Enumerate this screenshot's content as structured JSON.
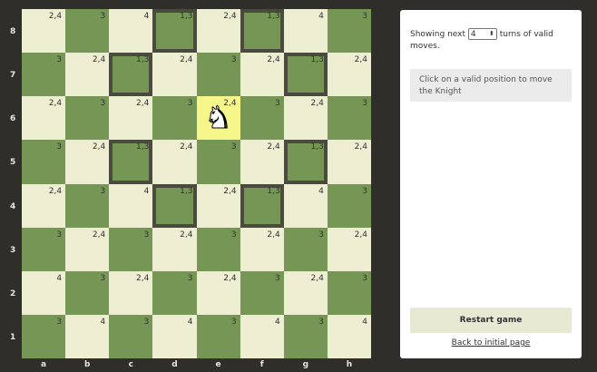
{
  "board": {
    "files": [
      "a",
      "b",
      "c",
      "d",
      "e",
      "f",
      "g",
      "h"
    ],
    "ranks": [
      "8",
      "7",
      "6",
      "5",
      "4",
      "3",
      "2",
      "1"
    ],
    "knight_square": "e6",
    "knight_glyph": "♞",
    "highlighted_squares": [
      "d8",
      "f8",
      "c7",
      "g7",
      "c5",
      "g5",
      "d4",
      "f4"
    ],
    "moves": [
      [
        "2,4",
        "3",
        "4",
        "1,3",
        "2,4",
        "1,3",
        "4",
        "3"
      ],
      [
        "3",
        "2,4",
        "1,3",
        "2,4",
        "3",
        "2,4",
        "1,3",
        "2,4"
      ],
      [
        "2,4",
        "3",
        "2,4",
        "3",
        "2,4",
        "3",
        "2,4",
        "3"
      ],
      [
        "3",
        "2,4",
        "1,3",
        "2,4",
        "3",
        "2,4",
        "1,3",
        "2,4"
      ],
      [
        "2,4",
        "3",
        "4",
        "1,3",
        "2,4",
        "1,3",
        "4",
        "3"
      ],
      [
        "3",
        "2,4",
        "3",
        "2,4",
        "3",
        "2,4",
        "3",
        "2,4"
      ],
      [
        "4",
        "3",
        "2,4",
        "3",
        "2,4",
        "3",
        "2,4",
        "3"
      ],
      [
        "3",
        "4",
        "3",
        "4",
        "3",
        "4",
        "3",
        "4"
      ]
    ]
  },
  "panel": {
    "showing_prefix": "Showing next",
    "turns_value": "4",
    "turns_suffix": "turns of valid moves.",
    "hint": "Click on a valid position to move the Knight",
    "restart_label": "Restart game",
    "back_label": "Back to initial page"
  },
  "colors": {
    "light": "#eeeed2",
    "dark": "#769656",
    "selected": "#f6f68a",
    "highlight_border": "#4b4a3f"
  }
}
